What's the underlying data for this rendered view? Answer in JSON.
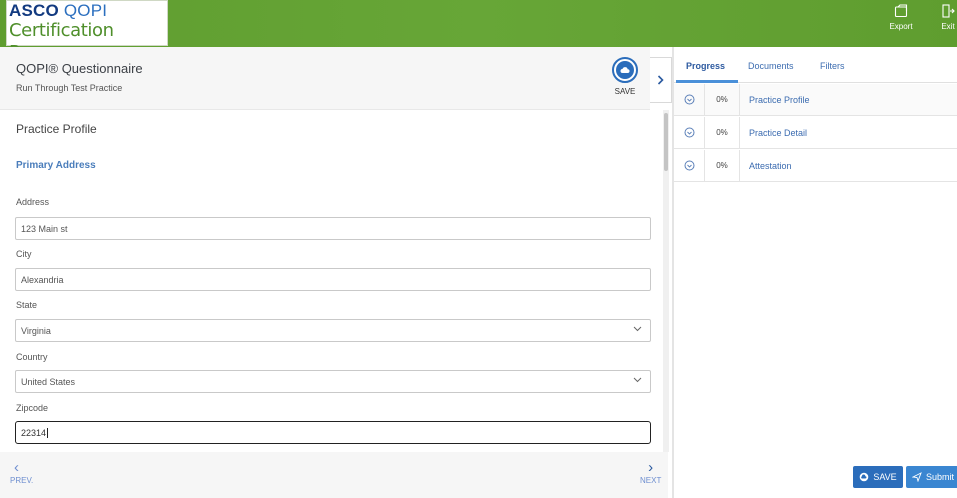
{
  "header": {
    "logo_line1_bold": "ASCO",
    "logo_line1_rest": "QOPI",
    "logo_line2": "Certification Program",
    "export_label": "Export",
    "exit_label": "Exit"
  },
  "questionnaire": {
    "title": "QOPI® Questionnaire",
    "subtitle": "Run Through Test Practice",
    "save_label": "SAVE"
  },
  "form": {
    "section_title": "Practice Profile",
    "subsection_title": "Primary Address",
    "fields": [
      {
        "label": "Address",
        "value": "123 Main st"
      },
      {
        "label": "City",
        "value": "Alexandria"
      },
      {
        "label": "State",
        "value": "Virginia"
      },
      {
        "label": "Country",
        "value": "United States"
      },
      {
        "label": "Zipcode",
        "value": "22314"
      }
    ]
  },
  "nav": {
    "prev_label": "PREV.",
    "next_label": "NEXT"
  },
  "right_panel": {
    "tabs": [
      {
        "label": "Progress",
        "active": true
      },
      {
        "label": "Documents",
        "active": false
      },
      {
        "label": "Filters",
        "active": false
      }
    ],
    "progress_rows": [
      {
        "percent": "0%",
        "name": "Practice Profile"
      },
      {
        "percent": "0%",
        "name": "Practice Detail"
      },
      {
        "percent": "0%",
        "name": "Attestation"
      }
    ],
    "save_button": "SAVE",
    "submit_button": "Submit"
  },
  "colors": {
    "header_green": "#67a637",
    "primary_blue": "#2b6dbb",
    "link_blue": "#3c6cb0"
  }
}
